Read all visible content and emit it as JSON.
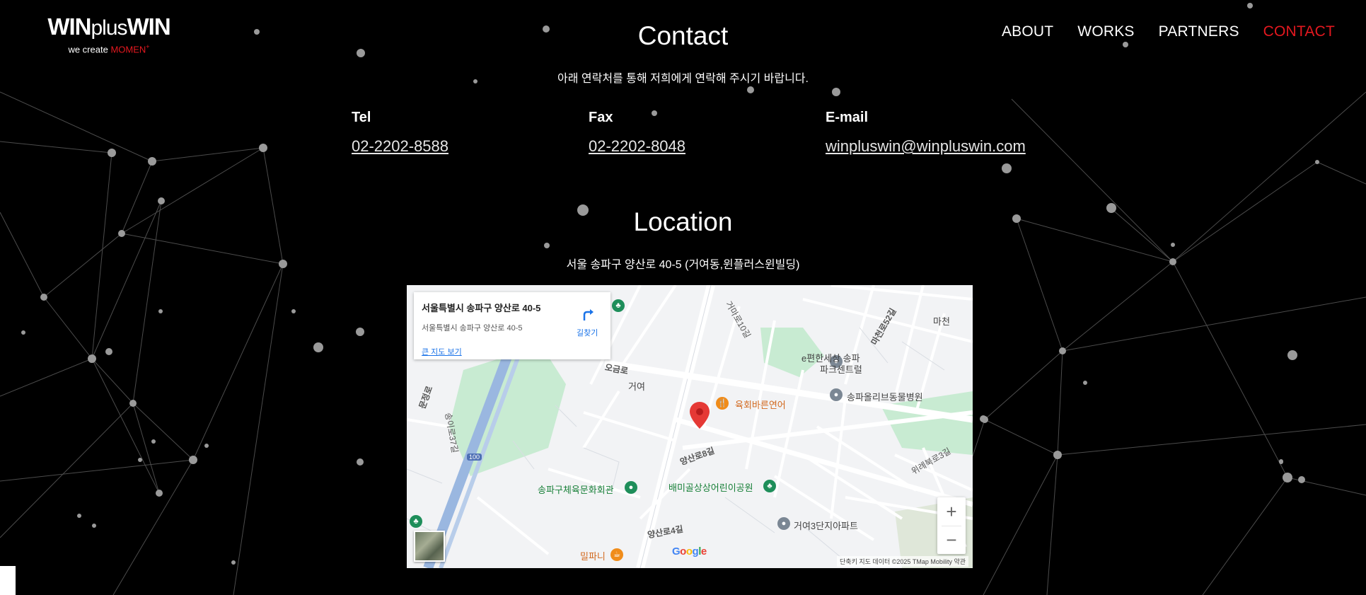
{
  "header": {
    "logo_part1": "WIN",
    "logo_part2": "plus",
    "logo_part3": "WIN",
    "tagline_prefix": "we create",
    "tagline_accent": "MOMEN",
    "tagline_plus": "+",
    "nav": [
      {
        "label": "ABOUT"
      },
      {
        "label": "WORKS"
      },
      {
        "label": "PARTNERS"
      },
      {
        "label": "CONTACT"
      }
    ]
  },
  "contact": {
    "title": "Contact",
    "subtitle": "아래 연락처를 통해 저희에게 연락해 주시기 바랍니다.",
    "tel_label": "Tel",
    "tel_value": "02-2202-8588",
    "fax_label": "Fax",
    "fax_value": "02-2202-8048",
    "email_label": "E-mail",
    "email_value": "winpluswin@winpluswin.com"
  },
  "location": {
    "title": "Location",
    "address": "서울 송파구 양산로 40-5 (거여동,윈플러스윈빌딩)"
  },
  "map": {
    "card_title": "서울특별시 송파구 양산로 40-5",
    "card_address": "서울특별시 송파구 양산로 40-5",
    "card_link": "큰 지도 보기",
    "directions_label": "길찾기",
    "zoom_in": "+",
    "zoom_out": "−",
    "footer": "단축키   지도 데이터 ©2025 TMap Mobility   약관",
    "google": "Google",
    "labels": [
      {
        "text": "송파구체육문화회관"
      },
      {
        "text": "배미골상상어린이공원"
      },
      {
        "text": "육회바른연어"
      },
      {
        "text": "송파올리브동물병원"
      },
      {
        "text": "e편한세상 송파"
      },
      {
        "text": "파크센트럴"
      },
      {
        "text": "거여3단지아파트"
      },
      {
        "text": "밀파니"
      },
      {
        "text": "마천"
      },
      {
        "text": "거여"
      },
      {
        "text": "양산로8길"
      },
      {
        "text": "양산로4길"
      },
      {
        "text": "오금로"
      },
      {
        "text": "문정로"
      },
      {
        "text": "송이로37길"
      },
      {
        "text": "위례북로3길"
      },
      {
        "text": "마천로52길"
      },
      {
        "text": "거마로10길"
      },
      {
        "text": "100"
      }
    ]
  },
  "colors": {
    "accent": "#e4181f",
    "background": "#000000",
    "map_park": "#c8e6c9",
    "map_road": "#ffffff"
  }
}
